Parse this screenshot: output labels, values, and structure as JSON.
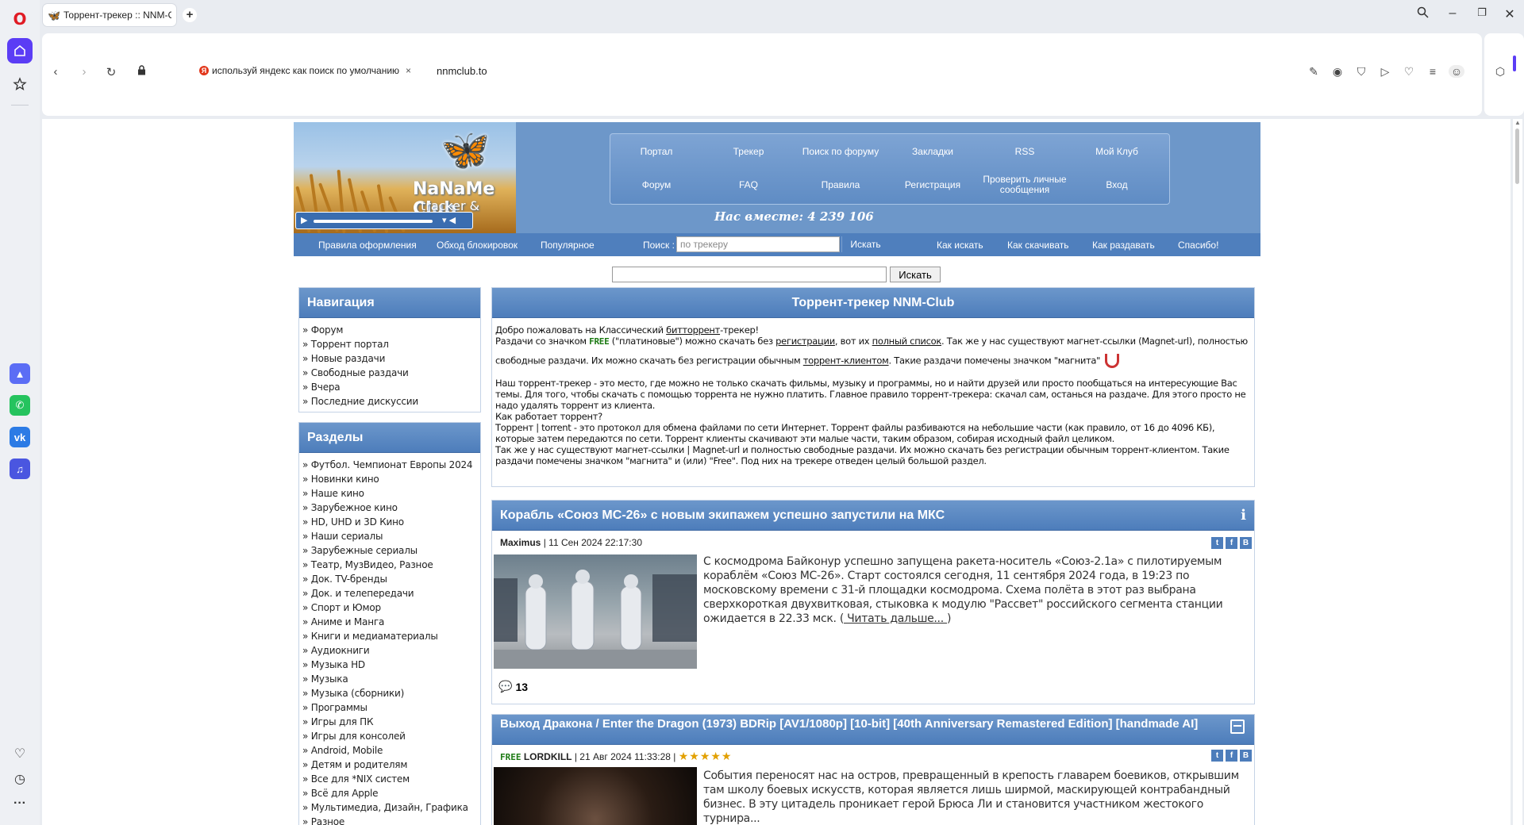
{
  "browser": {
    "tab_title": "Торрент-трекер :: NNM-Club",
    "tab_add": "+",
    "search_hint": "используй яндекс как поиск по умолчанию",
    "search_hint_close": "×",
    "url": "nnmclub.to"
  },
  "site": {
    "logo_title": "NaNaMe Club",
    "logo_subtitle": "tracker & forum",
    "top_nav": [
      {
        "label": "Портал"
      },
      {
        "label": "Трекер"
      },
      {
        "label": "Поиск по форуму"
      },
      {
        "label": "Закладки"
      },
      {
        "label": "RSS"
      },
      {
        "label": "Мой Клуб"
      },
      {
        "label": "Форум"
      },
      {
        "label": "FAQ"
      },
      {
        "label": "Правила"
      },
      {
        "label": "Регистрация"
      },
      {
        "label": "Проверить личные сообщения"
      },
      {
        "label": "Вход"
      }
    ],
    "counter": "Нас вместе: 4 239 106",
    "sub_nav": {
      "rules": "Правила оформления",
      "bypass": "Обход блокировок",
      "popular": "Популярное",
      "search_label": "Поиск :",
      "search_placeholder": "по трекеру",
      "search_button": "Искать",
      "how_search": "Как искать",
      "how_download": "Как скачивать",
      "how_seed": "Как раздавать",
      "thanks": "Спасибо!"
    },
    "search2_button": "Искать"
  },
  "navigation": {
    "title": "Навигация",
    "items": [
      "Форум",
      "Торрент портал",
      "Новые раздачи",
      "Свободные раздачи",
      "Вчера",
      "Последние дискуссии"
    ]
  },
  "sections": {
    "title": "Разделы",
    "items": [
      "Футбол. Чемпионат Европы 2024",
      "Новинки кино",
      "Наше кино",
      "Зарубежное кино",
      "HD, UHD и 3D Кино",
      "Наши сериалы",
      "Зарубежные сериалы",
      "Театр, МузВидео, Разное",
      "Док. TV-бренды",
      "Док. и телепередачи",
      "Спорт и Юмор",
      "Аниме и Манга",
      "Книги и медиаматериалы",
      "Аудиокниги",
      "Музыка HD",
      "Музыка",
      "Музыка (сборники)",
      "Программы",
      "Игры для ПК",
      "Игры для консолей",
      "Android, Mobile",
      "Детям и родителям",
      "Все для *NIX систем",
      "Всё для Apple",
      "Мультимедиа, Дизайн, Графика",
      "Разное"
    ]
  },
  "welcome": {
    "title": "Торрент-трекер NNM-Club",
    "line1_a": "Добро пожаловать на Классический ",
    "line1_link": "битторрент",
    "line1_b": "-трекер!",
    "line2_a": "Раздачи со значком ",
    "line2_free": "FREE",
    "line2_b": " (\"платиновые\") можно скачать без ",
    "line2_link1": "регистрации",
    "line2_c": ", вот их ",
    "line2_link2": "полный список",
    "line2_d": ". Так же у нас существуют магнет-ссылки (Magnet-url), полностью",
    "line3_a": "свободные раздачи. Их можно скачать без регистрации обычным ",
    "line3_link": "торрент-клиентом",
    "line3_b": ". Такие раздачи помечены значком \"магнита\"",
    "para2": "Наш торрент-трекер - это место, где можно не только скачать фильмы, музыку и программы, но и найти друзей или просто пообщаться на интересующие Вас темы. Для того, чтобы скачать с помощью торрента не нужно платить. Главное правило торрент-трекера: скачал сам, останься на раздаче. Для этого просто не надо удалять торрент из клиента.",
    "para3": "Как работает торрент?",
    "para4": "Торрент | torrent - это протокол для обмена файлами по сети Интернет. Торрент файлы разбиваются на небольшие части (как правило, от 16 до 4096 КБ), которые затем передаются по сети. Торрент клиенты скачивают эти малые части, таким образом, собирая исходный файл целиком.",
    "para5": "Так же у нас существуют магнет-ссылки | Magnet-url и полностью свободные раздачи. Их можно скачать без регистрации обычным торрент-клиентом. Такие раздачи помечены значком \"магнита\" и (или) \"Free\". Под них на трекере отведен целый большой раздел."
  },
  "news": [
    {
      "title": "Корабль «Союз МС-26» с новым экипажем успешно запустили на МКС",
      "author": "Maximus",
      "date": "| 11 Сен 2024 22:17:30",
      "text": "С космодрома Байконур успешно запущена ракета-носитель «Союз-2.1а» с пилотируемым кораблём «Союз МС-26». Старт состоялся сегодня, 11 сентября 2024 года, в 19:23 по московскому времени с 31-й площадки космодрома. Схема полёта в этот раз выбрана сверхкороткая двухвитковая, стыковка к модулю \"Рассвет\" российского сегмента станции ожидается в 22.33 мск. (",
      "read_more": " Читать дальше... ",
      "close_paren": ")",
      "comments": "13"
    },
    {
      "title": "Выход Дракона / Enter the Dragon (1973) BDRip [AV1/1080p] [10-bit] [40th Anniversary Remastered Edition] [handmade AI]",
      "free": "FREE",
      "author": "LORDKILL",
      "date": "| 21 Авг 2024 11:33:28 |",
      "stars": "★★★★★",
      "text": "События переносят нас на остров, превращенный в крепость главарем боевиков, открывшим там школу боевых искусств, которая является лишь ширмой, маскирующей контрабандный бизнес. В эту цитадель проникает герой Брюса Ли и становится участником жестокого турнира..."
    }
  ]
}
